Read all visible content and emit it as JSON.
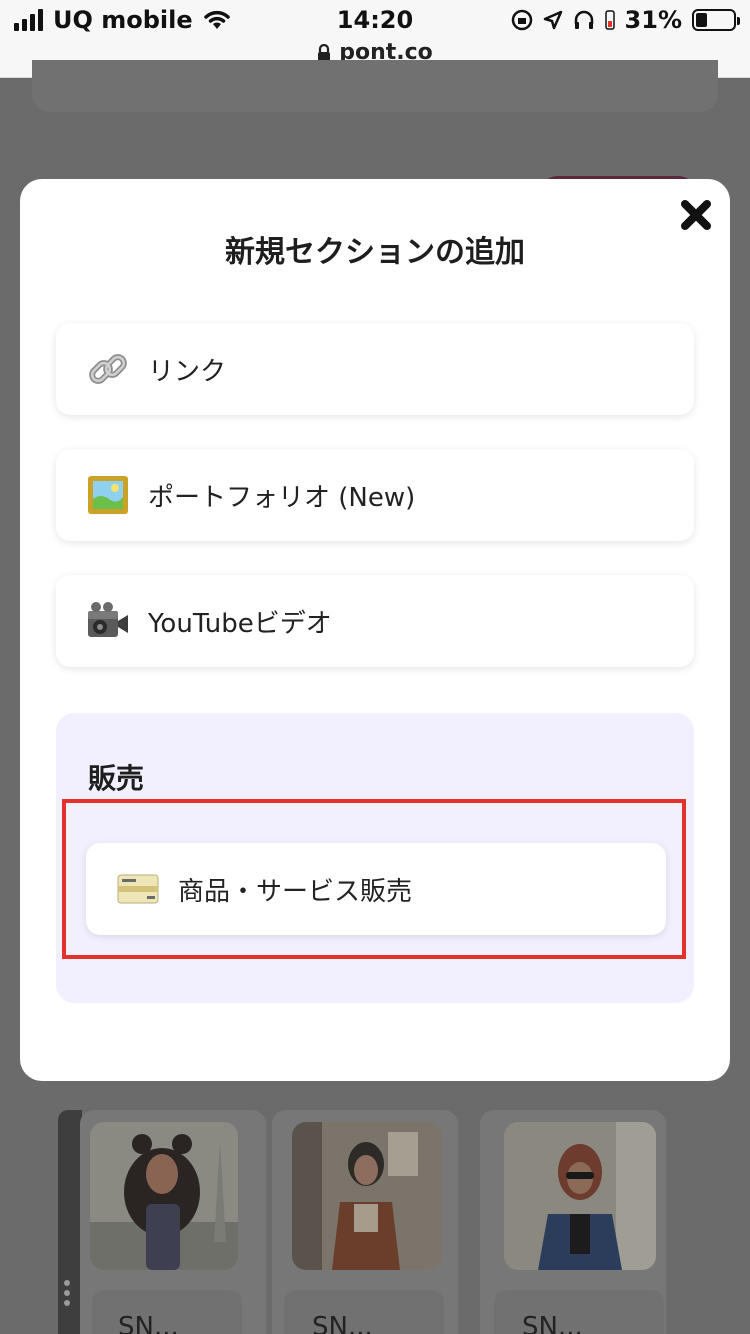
{
  "status_bar": {
    "carrier": "UQ mobile",
    "time": "14:20",
    "battery": "31%",
    "battery_level": 0.31,
    "url": "pont.co"
  },
  "modal": {
    "title": "新規セクションの追加",
    "close_icon": "close-x-icon",
    "options": [
      {
        "icon": "link-icon",
        "label": "リンク"
      },
      {
        "icon": "picture-frame-icon",
        "label": "ポートフォリオ (New)"
      },
      {
        "icon": "video-camera-icon",
        "label": "YouTubeビデオ"
      }
    ],
    "sales": {
      "title": "販売",
      "option": {
        "icon": "credit-card-icon",
        "label": "商品・サービス販売"
      }
    }
  },
  "background": {
    "captions": [
      "SN...",
      "SN...",
      "SN..."
    ]
  },
  "colors": {
    "highlight": "#e2322b",
    "sales_panel": "#f2f0fe",
    "overlay": "#6b6b6b"
  }
}
